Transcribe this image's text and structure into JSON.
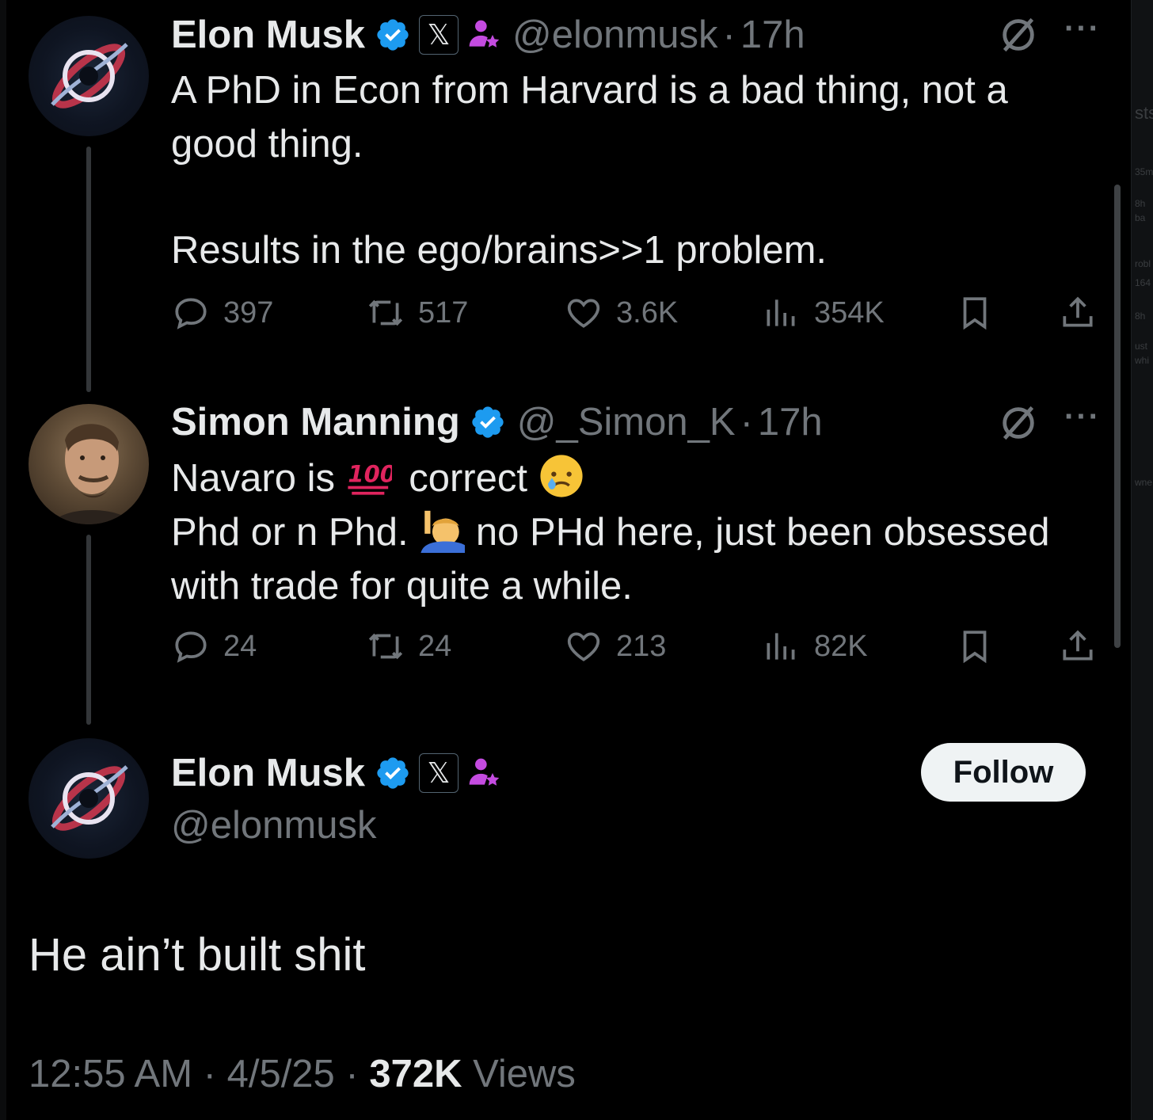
{
  "tweet1": {
    "name": "Elon Musk",
    "handle": "@elonmusk",
    "dot": "·",
    "time": "17h",
    "line1": "A PhD in Econ from Harvard is a bad thing, not a good thing.",
    "line2": "Results in the ego/brains>>1 problem.",
    "replies": "397",
    "reposts": "517",
    "likes": "3.6K",
    "views": "354K"
  },
  "tweet2": {
    "name": "Simon Manning",
    "handle": "@_Simon_K",
    "dot": "·",
    "time": "17h",
    "line1_a": "Navaro is",
    "line1_b": "correct",
    "line2_a": "Phd or n Phd.",
    "line2_b": "no PHd here, just been obsessed",
    "line3": "with trade for quite a while.",
    "replies": "24",
    "reposts": "24",
    "likes": "213",
    "views": "82K"
  },
  "main": {
    "name": "Elon Musk",
    "handle": "@elonmusk",
    "follow_label": "Follow",
    "text": "He ain’t built shit",
    "meta_time": "12:55 AM",
    "meta_sep1": " · ",
    "meta_date": "4/5/25",
    "meta_sep2": " · ",
    "meta_views_count": "372K",
    "meta_views_label": " Views"
  },
  "badges": {
    "x_badge": "𝕏"
  },
  "icons": {
    "verified": "verified-badge-icon",
    "reply": "reply-icon",
    "repost": "repost-icon",
    "like": "heart-icon",
    "views": "views-icon",
    "bookmark": "bookmark-icon",
    "share": "share-icon",
    "grok": "grok-icon",
    "more": "more-icon"
  },
  "colors": {
    "background": "#000000",
    "text": "#e7e9ea",
    "muted": "#71767b",
    "verified_blue": "#1d9bf0",
    "affiliate_purple": "#c44be0"
  }
}
